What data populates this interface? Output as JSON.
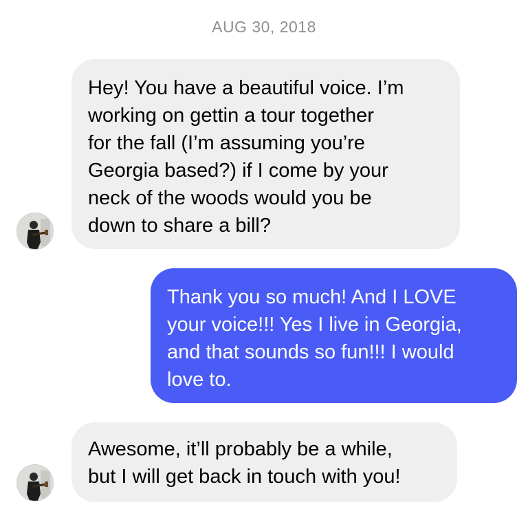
{
  "thread": {
    "date_label": "AUG 30, 2018",
    "messages": [
      {
        "direction": "incoming",
        "text": "Hey! You have a beautiful voice. I’m\nworking on gettin a tour together\nfor the fall (I’m assuming you’re\nGeorgia based?) if I come by your\nneck of the woods would you be\ndown to share a bill?"
      },
      {
        "direction": "outgoing",
        "text": "Thank you so much! And I LOVE\nyour voice!!! Yes I live in Georgia,\nand that sounds so fun!!!  I would\nlove to."
      },
      {
        "direction": "incoming",
        "text": "Awesome, it’ll probably be a while,\nbut I will get back in touch with you!"
      }
    ]
  },
  "colors": {
    "incoming_bubble": "#efefef",
    "outgoing_bubble": "#4a5cf5",
    "date_text": "#8e8e93"
  },
  "icons": {
    "avatar": "avatar-image"
  }
}
